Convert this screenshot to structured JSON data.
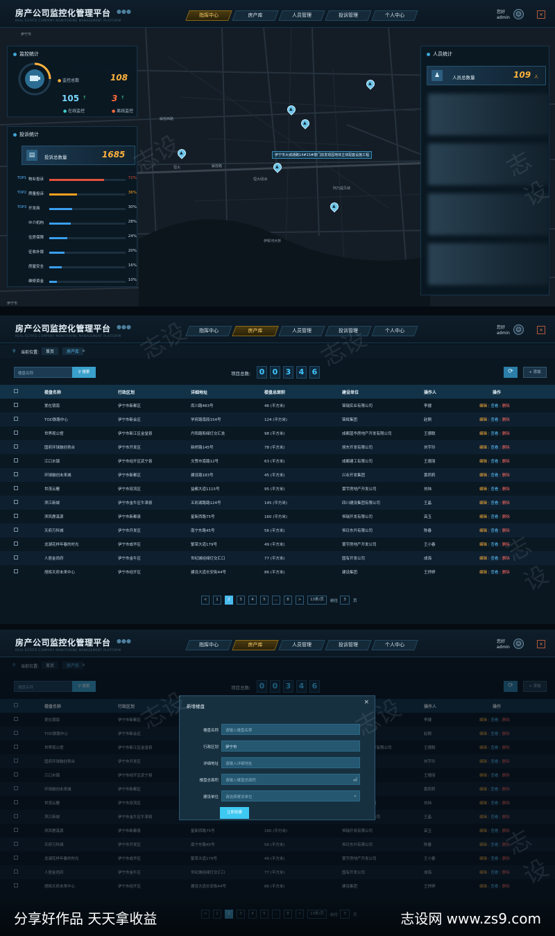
{
  "header": {
    "title": "房产公司监控化管理平台",
    "subtitle": "REAL ESTATE COMPANY MONITORING MANAGEMENT PLATFORM",
    "nav": [
      "指挥中心",
      "房产库",
      "人员管理",
      "投诉管理",
      "个人中心"
    ],
    "greeting": "您好",
    "username": "admin"
  },
  "monitor": {
    "title": "监控统计",
    "total_label": "监控总数",
    "total": "108",
    "online": "105",
    "offline": "3",
    "online_label": "在线监控",
    "offline_label": "离线监控"
  },
  "complaints": {
    "title": "投诉统计",
    "total_label": "投诉总数量",
    "total": "1685",
    "items": [
      {
        "tag": "TOP1",
        "name": "物业投诉",
        "pct": "72%",
        "level": 0.72,
        "color": "#e2523a"
      },
      {
        "tag": "TOP2",
        "name": "质量投诉",
        "pct": "36%",
        "level": 0.36,
        "color": "#ffa21f"
      },
      {
        "tag": "TOP3",
        "name": "开发商",
        "pct": "30%",
        "level": 0.3,
        "color": "#3a9ff0"
      },
      {
        "tag": "",
        "name": "中介机构",
        "pct": "28%",
        "level": 0.28,
        "color": "#3a9ff0"
      },
      {
        "tag": "",
        "name": "住房保障",
        "pct": "24%",
        "level": 0.24,
        "color": "#3a9ff0"
      },
      {
        "tag": "",
        "name": "征收补偿",
        "pct": "20%",
        "level": 0.2,
        "color": "#3a9ff0"
      },
      {
        "tag": "",
        "name": "房屋安全",
        "pct": "16%",
        "level": 0.16,
        "color": "#3a9ff0"
      },
      {
        "tag": "",
        "name": "维修资金",
        "pct": "10%",
        "level": 0.1,
        "color": "#3a9ff0"
      }
    ]
  },
  "staff": {
    "title": "人员统计",
    "total_label": "人员总数量",
    "total": "109",
    "unit": "人"
  },
  "map": {
    "labels": [
      "伊宁市",
      "伊宁市",
      "解放西路",
      "解放路",
      "伊宁市",
      "阿乃提贝纳",
      "恒大绿洲",
      "伊宁市大城通路",
      "恒大",
      "伊犁河大桥",
      "伊宁市"
    ],
    "callout": "伊宁市大城通路14#15#楼门前发现因地体主体配套设施工程"
  },
  "toolbar": {
    "breadcrumb_label": "当前位置:",
    "crumb_home": "首页",
    "crumb_tab": "房产库",
    "search_placeholder": "楼盘名称",
    "search_button": "搜索",
    "count_label": "项目总数:",
    "count_digits": [
      "0",
      "0",
      "3",
      "4",
      "6"
    ],
    "add_button": "+ 添加"
  },
  "table": {
    "columns": [
      "楼盘名称",
      "行政区划",
      "详细地址",
      "楼盘总面积",
      "建设单位",
      "操作人",
      "操作"
    ],
    "op_edit": "编辑",
    "op_view": "查看",
    "op_delete": "删除",
    "rows": [
      [
        "爱在镜南",
        "伊宁市新都区",
        "库川路483号",
        "46 (平方米)",
        "锦瑞实业有限公司",
        "李捷"
      ],
      [
        "TOD铁路中心",
        "伊宁市新会区",
        "学府路南段154号",
        "124 (平方米)",
        "锦辉集团",
        "赵刚"
      ],
      [
        "世界观公馆",
        "伊宁市新江区金堂县",
        "丹阳路和绿灯交汇处",
        "98 (平方米)",
        "成都蓝华房地产开发有限公司",
        "王德聪"
      ],
      [
        "国府环球融创青台",
        "伊宁市开发区",
        "新桥路145号",
        "78 (平方米)",
        "旭东开发有限公司",
        "刘宇玲"
      ],
      [
        "江口水镇",
        "伊宁市经开区武宁县",
        "文赞市南路12号",
        "63 (平方米)",
        "成都建工有限公司",
        "王德丽"
      ],
      [
        "环球融创未来城",
        "伊宁市新都区",
        "建设路183号",
        "45 (平方米)",
        "兴业开发集团",
        "黄莉莉"
      ],
      [
        "世茂云麓",
        "伊宁市双流区",
        "益都大道1115号",
        "95 (平方米)",
        "寰宇房地产开发公司",
        "刘炜"
      ],
      [
        "滨江新城",
        "伊宁市金牛区牛津县",
        "五彩湖路路124号",
        "145 (平方米)",
        "四川建设集团有限公司",
        "王晶"
      ],
      [
        "滨凤鹿溪源",
        "伊宁市新都县",
        "星新西路75号",
        "160 (平方米)",
        "恒瑞开发有限公司",
        "高玉"
      ],
      [
        "天府万科城",
        "伊宁市开发区",
        "南宁东路45号",
        "56 (平方米)",
        "恒日东升有限公司",
        "陈春"
      ],
      [
        "龙湖花样年春的时光",
        "伊宁市成华区",
        "繁荣大道179号",
        "49 (平方米)",
        "寰宇房地产开发公司",
        "王小春"
      ],
      [
        "人居金尚府",
        "伊宁市金牛区",
        "世纪城经绿灯交汇口",
        "77 (平方米)",
        "国有开发公司",
        "成海"
      ],
      [
        "旭辉天府未来中心",
        "伊宁市经开区",
        "建设大道长安街44号",
        "86 (平方米)",
        "建设集团",
        "王妤婷"
      ]
    ]
  },
  "pager": {
    "pages": [
      "1",
      "2",
      "3",
      "4",
      "5",
      "...",
      "8"
    ],
    "active": "2",
    "prev": "<",
    "next": ">",
    "size": "13条/页",
    "goto": "前往",
    "goto_page": "3",
    "page_unit": "页"
  },
  "modal": {
    "title": "新增楼盘",
    "fields": [
      {
        "label": "楼盘名称",
        "value": "请输入楼盘名称"
      },
      {
        "label": "行政区划",
        "value": "伊宁市"
      },
      {
        "label": "详细地址",
        "value": "请输入详细地址"
      },
      {
        "label": "楼盘总面积",
        "value": "请输入楼盘总面积"
      },
      {
        "label": "建设单位",
        "value": "请选择建设单位"
      }
    ],
    "submit": "立即创建"
  },
  "watermark": {
    "mark": "志设",
    "footer_left": "分享好作品 天天拿收益",
    "footer_right": "志设网 www.zs9.com"
  }
}
